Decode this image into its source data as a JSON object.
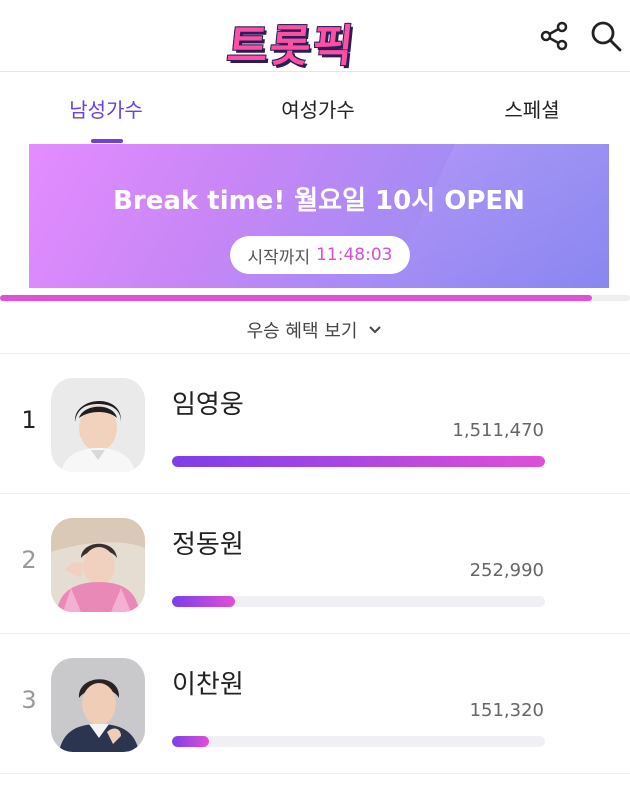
{
  "header": {
    "logo_text": "트롯픽",
    "icons": [
      "share-icon",
      "search-icon"
    ]
  },
  "tabs": [
    {
      "label": "남성가수",
      "active": true
    },
    {
      "label": "여성가수",
      "active": false
    },
    {
      "label": "스페셜",
      "active": false
    }
  ],
  "banner": {
    "title": "Break time! 월요일 10시 OPEN",
    "countdown_label": "시작까지",
    "countdown_time": "11:48:03"
  },
  "progress": {
    "fraction": 0.94,
    "color": "#e04fd8"
  },
  "benefit": {
    "label": "우승 혜택 보기"
  },
  "ranking": [
    {
      "rank": "1",
      "name": "임영웅",
      "votes": "1,511,470",
      "fraction": 1.0
    },
    {
      "rank": "2",
      "name": "정동원",
      "votes": "252,990",
      "fraction": 0.17
    },
    {
      "rank": "3",
      "name": "이찬원",
      "votes": "151,320",
      "fraction": 0.1
    }
  ],
  "colors": {
    "accent": "#6b3fe0",
    "bar_start": "#7b3fe8",
    "bar_end": "#e04fd8"
  }
}
